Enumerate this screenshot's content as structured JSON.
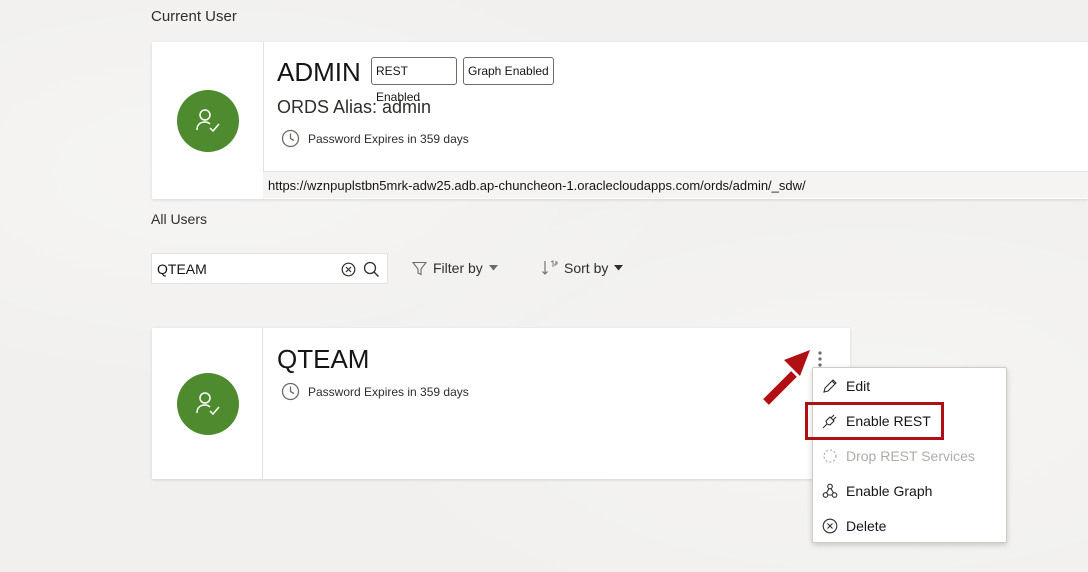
{
  "current_user": {
    "section_label": "Current User",
    "name": "ADMIN",
    "badges": [
      "REST Enabled",
      "Graph Enabled"
    ],
    "alias": "ORDS Alias: admin",
    "password_expiry": "Password Expires in 359 days",
    "url": "https://wznpuplstbn5mrk-adw25.adb.ap-chuncheon-1.oraclecloudapps.com/ords/admin/_sdw/",
    "avatar_color": "#4e8a2e"
  },
  "all_users": {
    "section_label": "All Users",
    "search": {
      "value": "QTEAM"
    },
    "filter_label": "Filter by",
    "sort_label": "Sort by"
  },
  "user_card": {
    "name": "QTEAM",
    "password_expiry": "Password Expires in 359 days",
    "avatar_color": "#4e8a2e"
  },
  "context_menu": {
    "items": [
      {
        "label": "Edit",
        "icon": "pencil-icon",
        "enabled": true
      },
      {
        "label": "Enable REST",
        "icon": "plug-icon",
        "enabled": true
      },
      {
        "label": "Drop REST Services",
        "icon": "dashed-circle-icon",
        "enabled": false
      },
      {
        "label": "Enable Graph",
        "icon": "graph-nodes-icon",
        "enabled": true
      },
      {
        "label": "Delete",
        "icon": "circle-x-icon",
        "enabled": true
      }
    ]
  },
  "annotation": {
    "color": "#b00f14"
  }
}
